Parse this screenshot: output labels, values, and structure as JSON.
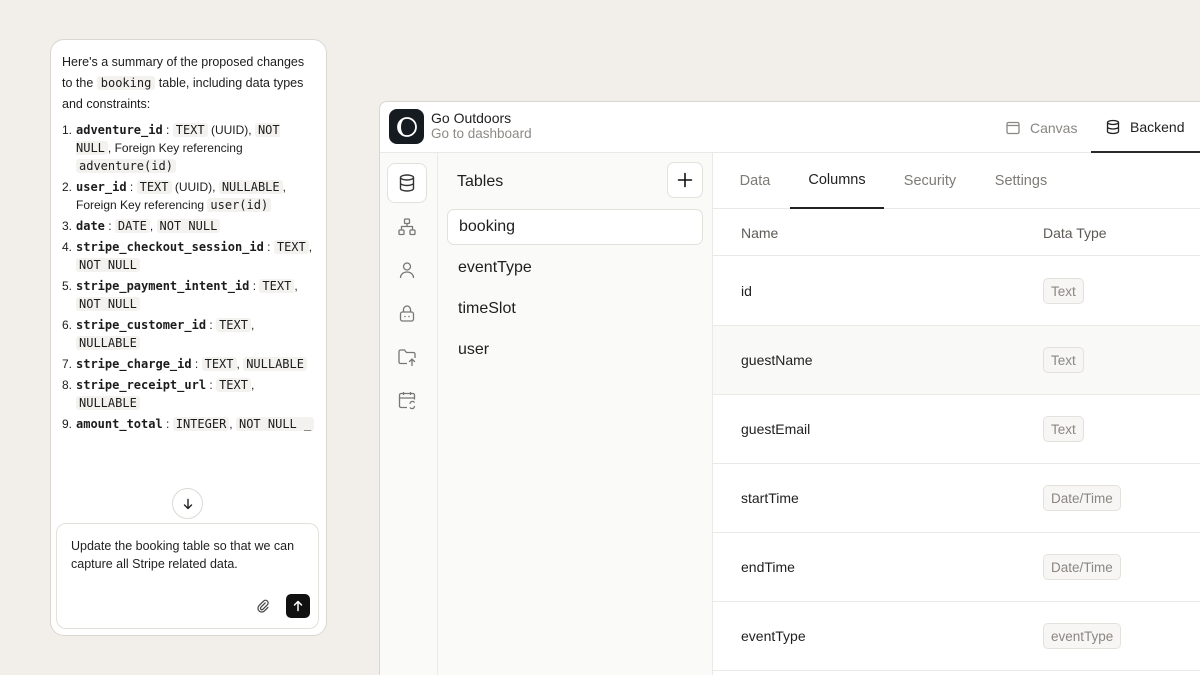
{
  "chat": {
    "intro_before": "Here's a summary of the proposed changes to the ",
    "intro_table": "booking",
    "intro_after": " table, including data types and constraints:",
    "changes": [
      {
        "num": "1.",
        "column": "adventure_id",
        "sep": " : ",
        "type": "TEXT",
        "note": " (UUID), ",
        "constraint": "NOT NULL",
        "extra": ", Foreign Key referencing ",
        "ref": "adventure(id)"
      },
      {
        "num": "2.",
        "column": "user_id",
        "sep": " : ",
        "type": "TEXT",
        "note": " (UUID), ",
        "constraint": "NULLABLE",
        "extra": ", Foreign Key referencing ",
        "ref": "user(id)"
      },
      {
        "num": "3.",
        "column": "date",
        "sep": " : ",
        "type": "DATE",
        "note": ", ",
        "constraint": "NOT NULL"
      },
      {
        "num": "4.",
        "column": "stripe_checkout_session_id",
        "sep": " : ",
        "type": "TEXT",
        "note": ", ",
        "constraint": "NOT NULL"
      },
      {
        "num": "5.",
        "column": "stripe_payment_intent_id",
        "sep": " : ",
        "type": "TEXT",
        "note": ", ",
        "constraint": "NOT NULL"
      },
      {
        "num": "6.",
        "column": "stripe_customer_id",
        "sep": " : ",
        "type": "TEXT",
        "note": ", ",
        "constraint": "NULLABLE"
      },
      {
        "num": "7.",
        "column": "stripe_charge_id",
        "sep": " : ",
        "type": "TEXT",
        "note": ", ",
        "constraint": "NULLABLE"
      },
      {
        "num": "8.",
        "column": "stripe_receipt_url",
        "sep": " : ",
        "type": "TEXT",
        "note": ", ",
        "constraint": "NULLABLE"
      },
      {
        "num": "9.",
        "column": "amount_total",
        "sep": " : ",
        "type": "INTEGER",
        "note": ", ",
        "constraint": "NOT NULL _"
      }
    ],
    "composer_text": "Update the booking table so that we can capture all Stripe related data.",
    "icons": {
      "scroll": "arrow-down-icon",
      "attach": "paperclip-icon",
      "send": "arrow-up-icon"
    }
  },
  "app": {
    "project_name": "Go Outdoors",
    "project_link": "Go to dashboard",
    "modes": {
      "canvas": "Canvas",
      "backend": "Backend"
    },
    "rail_icons": [
      "database-icon",
      "schema-icon",
      "user-icon",
      "lock-icon",
      "folder-upload-icon",
      "calendar-sync-icon"
    ],
    "tables_title": "Tables",
    "tables": [
      "booking",
      "eventType",
      "timeSlot",
      "user"
    ],
    "selected_table": "booking",
    "tabs": [
      "Data",
      "Columns",
      "Security",
      "Settings"
    ],
    "active_tab": "Columns",
    "column_headers": {
      "name": "Name",
      "type": "Data Type"
    },
    "columns": [
      {
        "name": "id",
        "type": "Text"
      },
      {
        "name": "guestName",
        "type": "Text"
      },
      {
        "name": "guestEmail",
        "type": "Text"
      },
      {
        "name": "startTime",
        "type": "Date/Time"
      },
      {
        "name": "endTime",
        "type": "Date/Time"
      },
      {
        "name": "eventType",
        "type": "eventType"
      }
    ]
  }
}
